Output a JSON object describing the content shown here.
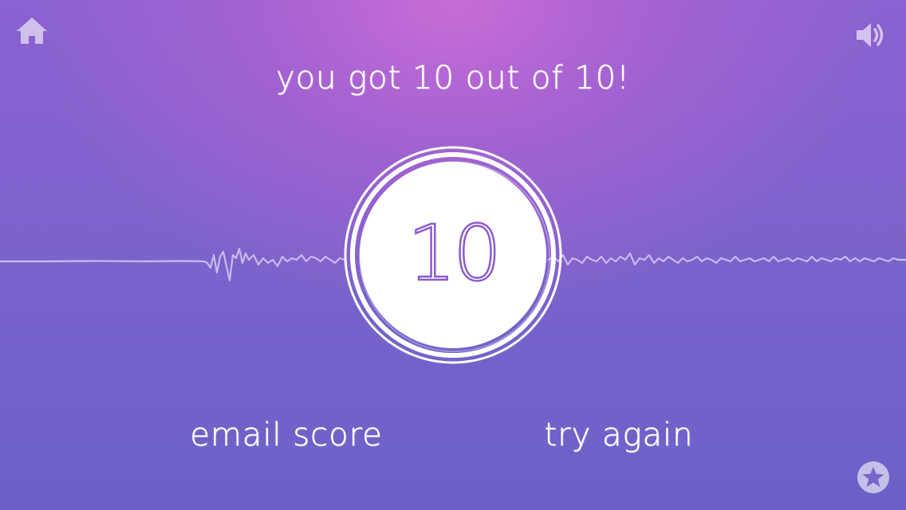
{
  "header": {
    "result_text": "you got 10 out of 10!"
  },
  "score": {
    "value": "10"
  },
  "actions": {
    "email_label": "email score",
    "retry_label": "try again"
  },
  "icons": {
    "home": "home-icon",
    "sound": "speaker-icon",
    "favorite": "star-icon"
  },
  "colors": {
    "accent": "#8b5ccf",
    "background_top": "#c86cd6",
    "background_bottom": "#6b61c8",
    "foreground": "#ffffff"
  }
}
